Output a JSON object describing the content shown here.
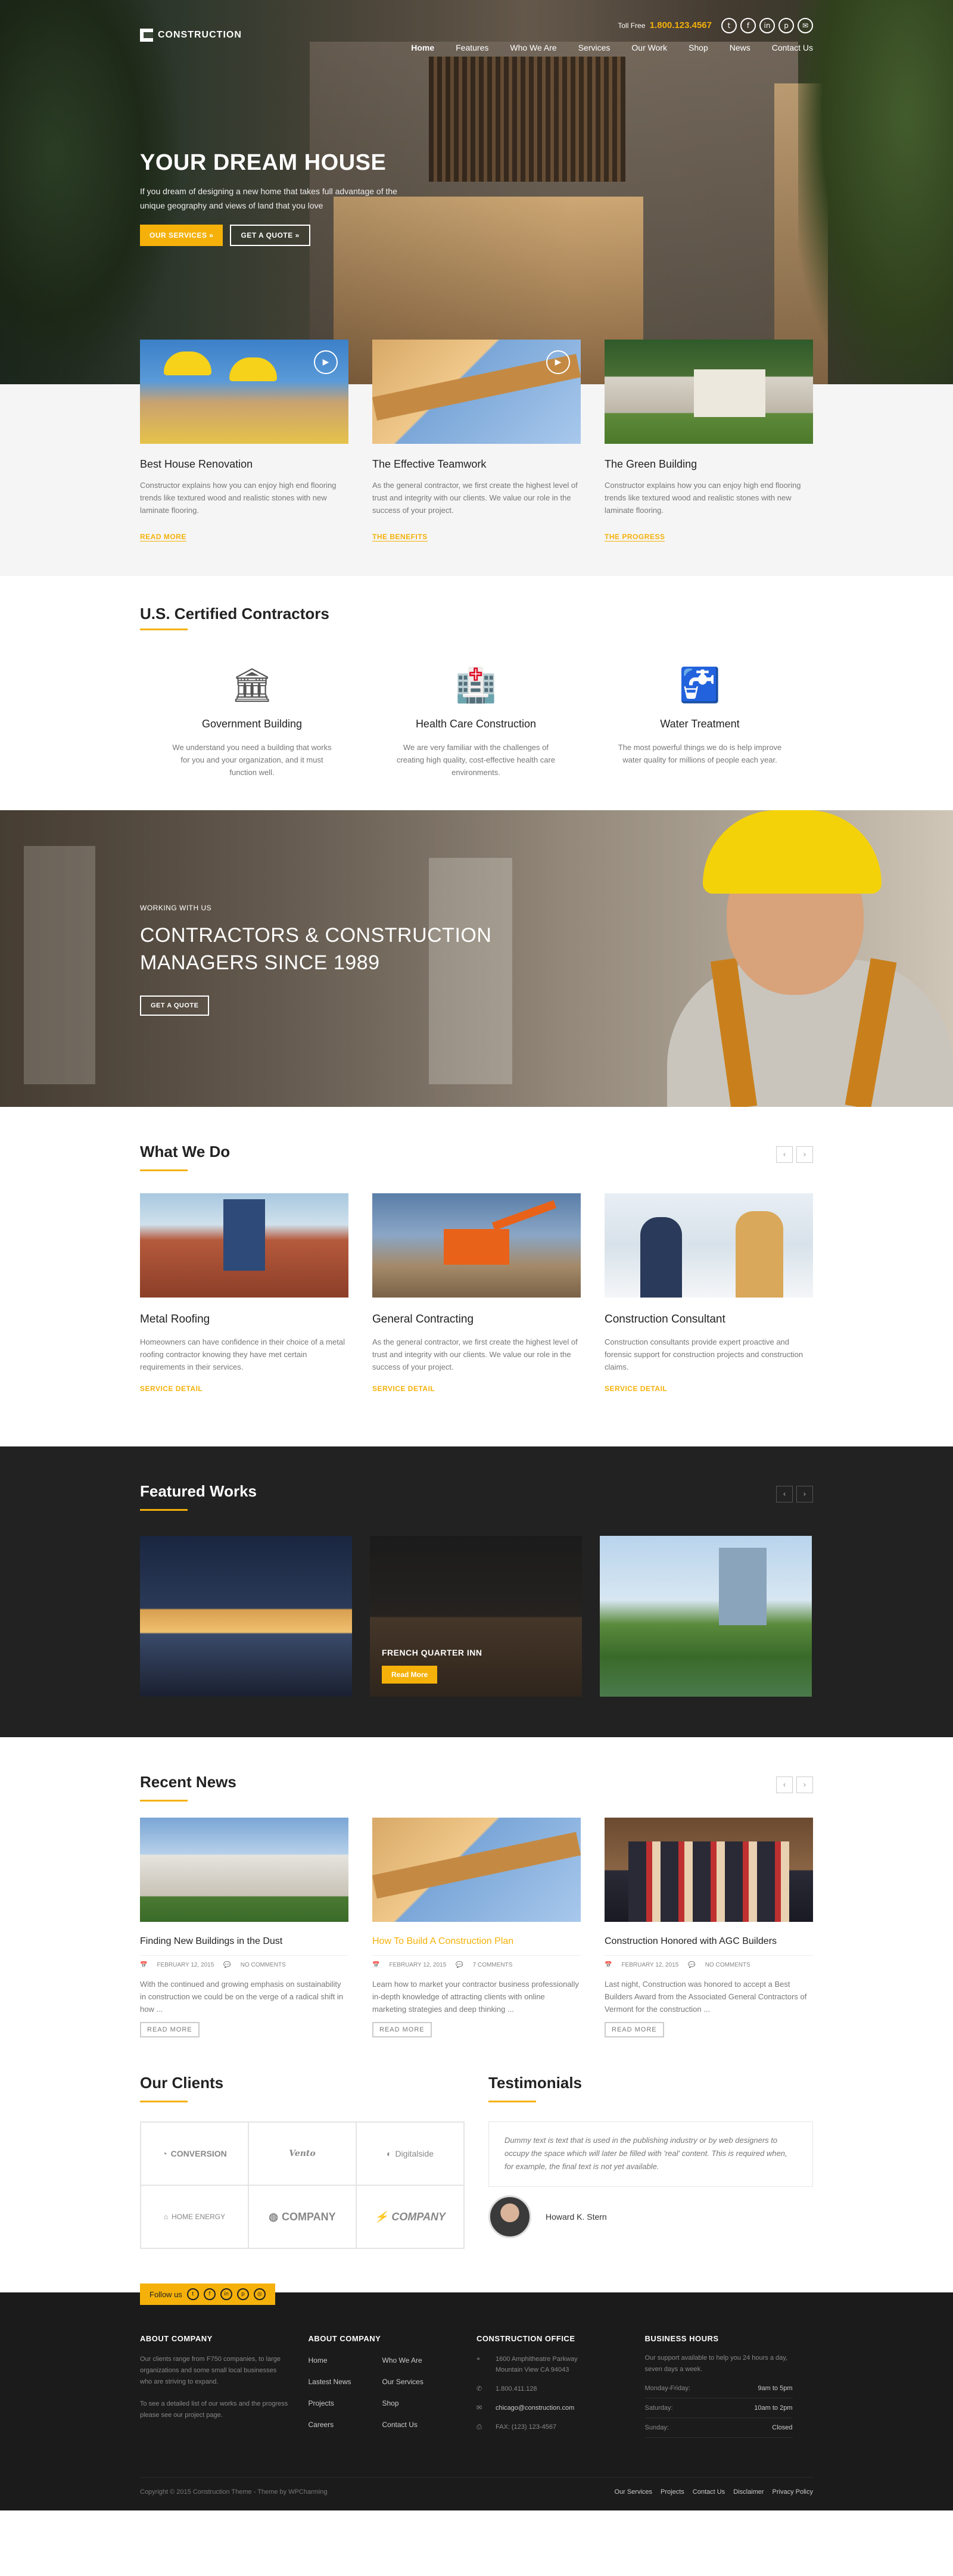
{
  "header": {
    "logo": "CONSTRUCTION",
    "tollfree_label": "Toll Free",
    "phone": "1.800.123.4567",
    "social": [
      "twitter-icon",
      "facebook-icon",
      "linkedin-icon",
      "pinterest-icon",
      "email-icon"
    ],
    "nav": [
      "Home",
      "Features",
      "Who We Are",
      "Services",
      "Our Work",
      "Shop",
      "News",
      "Contact Us"
    ]
  },
  "hero": {
    "title": "YOUR DREAM HOUSE",
    "text": "If you dream of designing a new home that takes full advantage of the unique geography and views of land that you love",
    "btn_services": "OUR SERVICES »",
    "btn_quote": "GET A QUOTE »"
  },
  "features": [
    {
      "title": "Best House Renovation",
      "text": "Constructor explains how you can enjoy high end flooring trends like textured wood and realistic stones with new laminate flooring.",
      "link": "READ MORE"
    },
    {
      "title": "The Effective Teamwork",
      "text": "As the general contractor, we first create the highest level of trust and integrity with our clients. We value our role in the success of your project.",
      "link": "THE BENEFITS"
    },
    {
      "title": "The Green Building",
      "text": "Constructor explains how you can enjoy high end flooring trends like textured wood and realistic stones with new laminate flooring.",
      "link": "THE PROGRESS"
    }
  ],
  "certified": {
    "title": "U.S. Certified Contractors",
    "items": [
      {
        "title": "Government Building",
        "text": "We understand you need a building that works for you and your organization, and it must function well."
      },
      {
        "title": "Health Care Construction",
        "text": "We are very familiar with the challenges of creating high quality, cost-effective health care environments."
      },
      {
        "title": "Water Treatment",
        "text": "The most powerful things we do is help improve water quality for millions of people each year."
      }
    ]
  },
  "banner": {
    "small": "WORKING WITH US",
    "line1": "CONTRACTORS & CONSTRUCTION",
    "line2": "MANAGERS SINCE 1989",
    "btn": "GET A QUOTE"
  },
  "whatwedo": {
    "title": "What We Do",
    "items": [
      {
        "title": "Metal Roofing",
        "text": "Homeowners can have confidence in their choice of a metal roofing contractor knowing they have met certain requirements in their services.",
        "link": "SERVICE DETAIL"
      },
      {
        "title": "General Contracting",
        "text": "As the general contractor, we first create the highest level of trust and integrity with our clients. We value our role in the success of your project.",
        "link": "SERVICE DETAIL"
      },
      {
        "title": "Construction Consultant",
        "text": "Construction consultants provide expert proactive and forensic support for construction projects and construction claims.",
        "link": "SERVICE DETAIL"
      }
    ]
  },
  "works": {
    "title": "Featured Works",
    "caption": "FRENCH QUARTER INN",
    "btn": "Read More"
  },
  "news": {
    "title": "Recent News",
    "items": [
      {
        "title": "Finding New Buildings in the Dust",
        "date": "FEBRUARY 12, 2015",
        "comments": "NO COMMENTS",
        "text": "With the continued and growing emphasis on sustainability in construction we could be on the verge of a radical shift in how ...",
        "btn": "READ MORE"
      },
      {
        "title": "How To Build A Construction Plan",
        "date": "FEBRUARY 12, 2015",
        "comments": "7 COMMENTS",
        "text": "Learn how to market your contractor business professionally in-depth knowledge of attracting clients with online marketing strategies and deep thinking ...",
        "btn": "READ MORE"
      },
      {
        "title": "Construction Honored with AGC Builders",
        "date": "FEBRUARY 12, 2015",
        "comments": "NO COMMENTS",
        "text": "Last night, Construction was honored to accept a Best Builders Award from the Associated General Contractors of Vermont for the construction ...",
        "btn": "READ MORE"
      }
    ]
  },
  "clients": {
    "title": "Our Clients",
    "logos": [
      "CONVERSION",
      "Vento",
      "Digitalside",
      "HOME ENERGY",
      "COMPANY",
      "COMPANY"
    ]
  },
  "testimonials": {
    "title": "Testimonials",
    "quote": "Dummy text is text that is used in the publishing industry or by web designers to occupy the space which will later be filled with 'real' content. This is required when, for example, the final text is not yet available.",
    "author": "Howard K. Stern"
  },
  "footer": {
    "follow": "Follow us",
    "about_title": "ABOUT COMPANY",
    "about_text1": "Our clients range from F750 companies, to large organizations and some small local businesses who are striving to expand.",
    "about_text2": "To see a detailed list of our works and the progress please see our project page.",
    "links_title": "ABOUT COMPANY",
    "links": [
      "Home",
      "Who We Are",
      "Lastest News",
      "Our Services",
      "Projects",
      "Shop",
      "Careers",
      "Contact Us"
    ],
    "office_title": "CONSTRUCTION OFFICE",
    "address1": "1600 Amphitheatre Parkway",
    "address2": "Mountain View CA 94043",
    "phone": "1.800.411.128",
    "email": "chicago@construction.com",
    "fax": "FAX: (123) 123-4567",
    "hours_title": "BUSINESS HOURS",
    "hours_text": "Our support available to help you 24 hours a day, seven days a week.",
    "hours": [
      {
        "day": "Monday-Friday:",
        "time": "9am to 5pm"
      },
      {
        "day": "Saturday:",
        "time": "10am to 2pm"
      },
      {
        "day": "Sunday:",
        "time": "Closed"
      }
    ],
    "copyright": "Copyright © 2015 Construction Theme - Theme by WPCharming",
    "bottom_links": [
      "Our Services",
      "Projects",
      "Contact Us",
      "Disclaimer",
      "Privacy Policy"
    ]
  },
  "colors": {
    "accent": "#f5b10a",
    "dark": "#222222",
    "footer": "#1b1b1b"
  }
}
